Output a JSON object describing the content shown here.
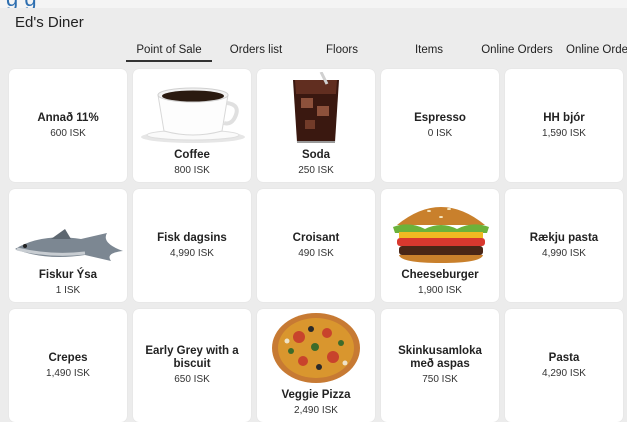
{
  "app": {
    "title": "Ed's Diner",
    "partial_heading": "g    g  "
  },
  "tabs": [
    {
      "label": "Point of Sale",
      "active": true
    },
    {
      "label": "Orders list",
      "active": false
    },
    {
      "label": "Floors",
      "active": false
    },
    {
      "label": "Items",
      "active": false
    },
    {
      "label": "Online Orders",
      "active": false
    },
    {
      "label": "Online Orde",
      "active": false
    }
  ],
  "items": [
    {
      "name": "Annað 11%",
      "price": "600 ISK"
    },
    {
      "name": "Coffee",
      "price": "800 ISK",
      "image": "coffee-cup-icon"
    },
    {
      "name": "Soda",
      "price": "250 ISK",
      "image": "soda-glass-icon"
    },
    {
      "name": "Espresso",
      "price": "0 ISK"
    },
    {
      "name": "HH bjór",
      "price": "1,590 ISK"
    },
    {
      "name": "Fiskur Ýsa",
      "price": "1 ISK",
      "image": "fish-icon"
    },
    {
      "name": "Fisk dagsins",
      "price": "4,990 ISK"
    },
    {
      "name": "Croisant",
      "price": "490 ISK"
    },
    {
      "name": "Cheeseburger",
      "price": "1,900 ISK",
      "image": "burger-icon"
    },
    {
      "name": "Rækju pasta",
      "price": "4,990 ISK"
    },
    {
      "name": "Crepes",
      "price": "1,490 ISK"
    },
    {
      "name": "Early Grey with a biscuit",
      "price": "650 ISK"
    },
    {
      "name": "Veggie Pizza",
      "price": "2,490 ISK",
      "image": "pizza-icon"
    },
    {
      "name": "Skinkusamloka með aspas",
      "price": "750 ISK"
    },
    {
      "name": "Pasta",
      "price": "4,290 ISK"
    }
  ]
}
